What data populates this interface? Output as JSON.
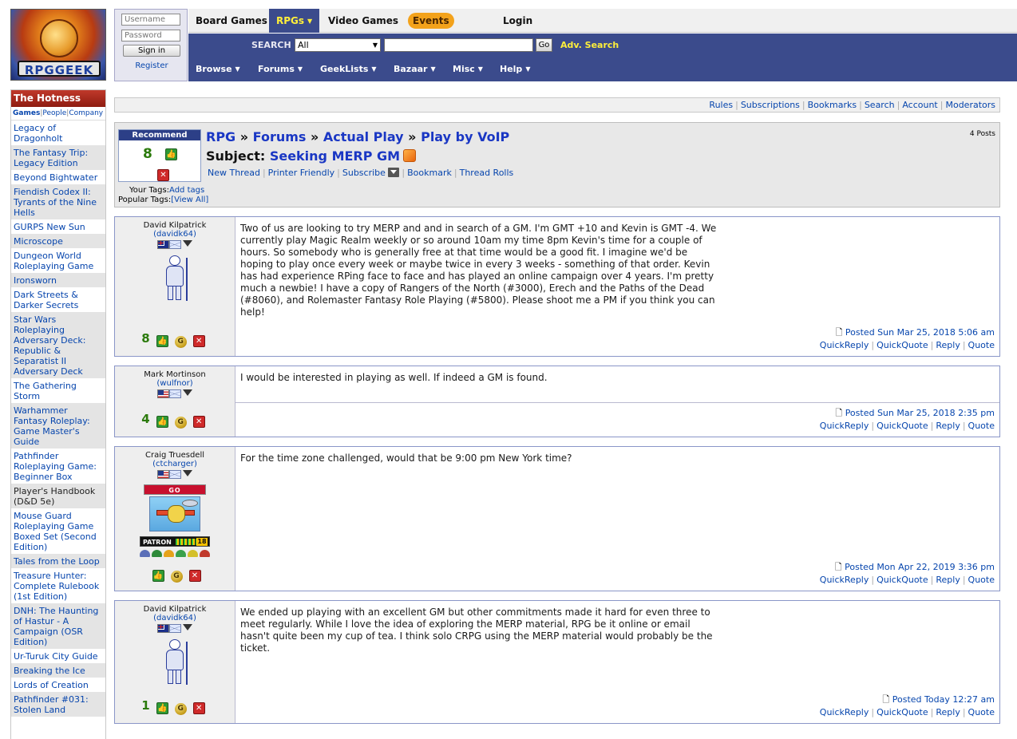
{
  "logo": {
    "text": "RPGGEEK"
  },
  "login": {
    "username_placeholder": "Username",
    "password_placeholder": "Password",
    "signin_label": "Sign in",
    "register_label": "Register"
  },
  "topnav": {
    "items": [
      "Board Games",
      "RPGs",
      "Video Games",
      "Events",
      "Login"
    ],
    "active": "RPGs"
  },
  "search": {
    "label": "SEARCH",
    "scope": "All",
    "go_label": "Go",
    "adv_label": "Adv. Search"
  },
  "menu": [
    "Browse",
    "Forums",
    "GeekLists",
    "Bazaar",
    "Misc",
    "Help"
  ],
  "hotness": {
    "title": "The Hotness",
    "tabs": [
      "Games",
      "People",
      "Company"
    ],
    "items": [
      "Legacy of Dragonholt",
      "The Fantasy Trip: Legacy Edition",
      "Beyond Bightwater",
      "Fiendish Codex II: Tyrants of the Nine Hells",
      "GURPS New Sun",
      "Microscope",
      "Dungeon World Roleplaying Game",
      "Ironsworn",
      "Dark Streets & Darker Secrets",
      "Star Wars Roleplaying Adversary Deck: Republic & Separatist II Adversary Deck",
      "The Gathering Storm",
      "Warhammer Fantasy Roleplay: Game Master's Guide",
      "Pathfinder Roleplaying Game: Beginner Box",
      "Player's Handbook (D&D 5e)",
      "Mouse Guard Roleplaying Game Boxed Set (Second Edition)",
      "Tales from the Loop",
      "Treasure Hunter: Complete Rulebook (1st Edition)",
      "DNH: The Haunting of Hastur - A Campaign (OSR Edition)",
      "Ur-Turuk City Guide",
      "Breaking the Ice",
      "Lords of Creation",
      "Pathfinder #031: Stolen Land"
    ]
  },
  "linkbar": [
    "Rules",
    "Subscriptions",
    "Bookmarks",
    "Search",
    "Account",
    "Moderators"
  ],
  "thread": {
    "recommend_label": "Recommend",
    "recommend_count": "8",
    "your_tags_label": "Your Tags:",
    "add_tags": "Add tags",
    "popular_tags_label": "Popular Tags:",
    "view_all": "[View All]",
    "crumbs": [
      "RPG",
      "Forums",
      "Actual Play",
      "Play by VoIP"
    ],
    "subject_label": "Subject:",
    "subject": "Seeking MERP GM",
    "actions": [
      "New Thread",
      "Printer Friendly",
      "Subscribe",
      "Bookmark",
      "Thread Rolls"
    ],
    "posts_count": "4 Posts"
  },
  "post_actions": [
    "QuickReply",
    "QuickQuote",
    "Reply",
    "Quote"
  ],
  "posts": [
    {
      "name": "David Kilpatrick",
      "handle": "(davidk64)",
      "thumbs": "8",
      "posted": "Posted Sun Mar 25, 2018 5:06 am",
      "body": "Two of us are looking to try MERP and and in search of a GM. I'm GMT +10 and Kevin is GMT -4. We currently play Magic Realm weekly or so around 10am my time 8pm Kevin's time for a couple of hours. So somebody who is generally free at that time would be a good fit. I imagine we'd be hoping to play once every week or maybe twice in every 3 weeks - something of that order. Kevin has had experience RPing face to face and has played an online campaign over 4 years. I'm pretty much a newbie! I have a copy of Rangers of the North (#3000), Erech and the Paths of the Dead (#8060), and Rolemaster Fantasy Role Playing (#5800). Please shoot me a PM if you think you can help!"
    },
    {
      "name": "Mark Mortinson",
      "handle": "(wulfnor)",
      "thumbs": "4",
      "posted": "Posted Sun Mar 25, 2018 2:35 pm",
      "body": "I would be interested in playing as well. If indeed a GM is found."
    },
    {
      "name": "Craig Truesdell",
      "handle": "(ctcharger)",
      "thumbs": "",
      "posted": "Posted Mon Apr 22, 2019 3:36 pm",
      "body": "For the time zone challenged, would that be 9:00 pm New York time?",
      "banner": "GO BUCKEYES!",
      "patron": "PATRON",
      "patron_year": "18"
    },
    {
      "name": "David Kilpatrick",
      "handle": "(davidk64)",
      "thumbs": "1",
      "posted": "Posted Today 12:27 am",
      "body": "We ended up playing with an excellent GM but other commitments made it hard for even three to meet regularly. While I love the idea of exploring the MERP material, RPG be it online or email hasn't quite been my cup of tea. I think solo CRPG using the MERP material would probably be the ticket."
    }
  ]
}
